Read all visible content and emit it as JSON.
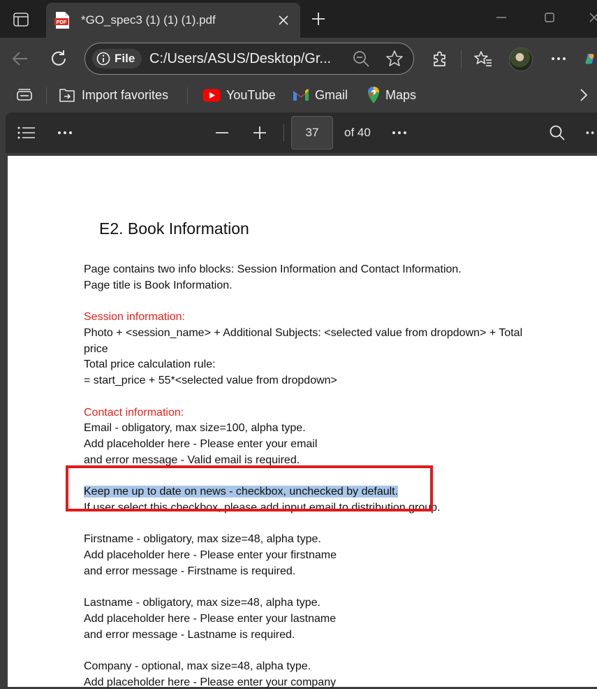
{
  "browser": {
    "tab_title": "*GO_spec3 (1) (1) (1).pdf",
    "favicon_text": "PDF",
    "site_info_label": "File",
    "url": "C:/Users/ASUS/Desktop/Gr...",
    "favorites": [
      {
        "label": "Import favorites",
        "icon": "import-favorites-icon"
      },
      {
        "label": "YouTube",
        "icon": "youtube-icon"
      },
      {
        "label": "Gmail",
        "icon": "gmail-icon"
      },
      {
        "label": "Maps",
        "icon": "maps-icon"
      }
    ]
  },
  "pdf_toolbar": {
    "current_page": "37",
    "page_count": "of 40"
  },
  "document": {
    "heading": "E2. Book Information",
    "lines": [
      "Page contains two info blocks: Session Information and Contact Information.",
      "Page title is Book Information.",
      "Session information:",
      "Photo + <session_name> + Additional Subjects: <selected value from dropdown> + Total",
      "price",
      "Total price calculation rule:",
      "= start_price + 55*<selected value from dropdown>",
      "Contact information:",
      "Email - obligatory, max size=100, alpha type.",
      "Add placeholder here - Please enter your email",
      "and error message - Valid email is required.",
      "Keep me up to date on news - checkbox, unchecked by default.",
      "If user select this checkbox, please add input email to distribution group.",
      "Firstname - obligatory, max size=48, alpha type.",
      "Add placeholder here - Please enter your firstname",
      "and error message - Firstname is required.",
      "Lastname - obligatory, max size=48, alpha type.",
      "Add placeholder here - Please enter your lastname",
      "and error message - Lastname is required.",
      "Company - optional, max size=48, alpha type.",
      "Add placeholder here - Please enter your company"
    ]
  },
  "colors": {
    "section_heading": "#e8221b",
    "selection_highlight": "#a8c6e8",
    "callout_border": "#e11b1b"
  }
}
